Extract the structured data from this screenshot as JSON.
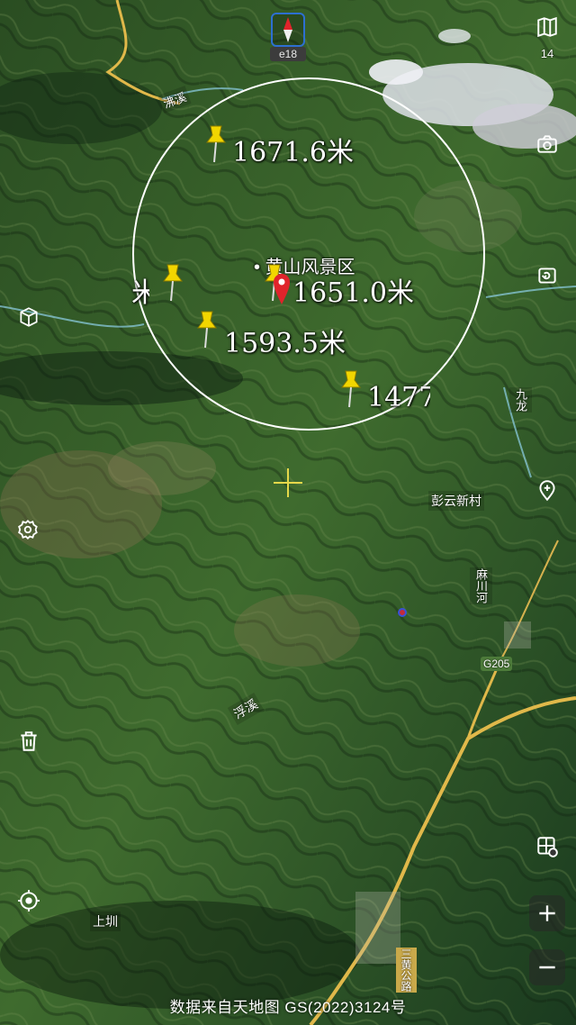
{
  "app": {
    "compass_label": "e18",
    "zoom_level": "14",
    "footer_text": "数据来自天地图 GS(2022)3124号"
  },
  "pins": [
    {
      "id": "pin-1",
      "label": "1671.6米"
    },
    {
      "id": "pin-2",
      "label": "1651.0米"
    },
    {
      "id": "pin-3",
      "label": "1593.5米"
    },
    {
      "id": "pin-4",
      "label": "1477"
    },
    {
      "id": "pin-5",
      "label": "米"
    }
  ],
  "places": {
    "scenic_area": "黄山风景区",
    "village": "彭云新村",
    "river": "浮溪",
    "road": "G205",
    "upper": "上圳",
    "stream1": "沸溪",
    "stream2": "九龙",
    "channel": "麻川河",
    "road_bottom": "三黄公路"
  },
  "colors": {
    "accent": "#2d6fd1",
    "pin_yellow": "#f2d600",
    "pin_red": "#e0242b",
    "road": "#e0b84a",
    "circle": "#ffffff"
  },
  "icons": {
    "layers": "book-map-icon",
    "camera": "camera-icon",
    "rotate": "rotate-camera-icon",
    "3d": "3d-cube-icon",
    "settings": "gear-location-icon",
    "location_add": "location-plus-icon",
    "delete": "trash-icon",
    "locate": "crosshair-locate-icon",
    "map_grid": "map-grid-icon",
    "zoom_in": "plus-icon",
    "zoom_out": "minus-icon"
  }
}
